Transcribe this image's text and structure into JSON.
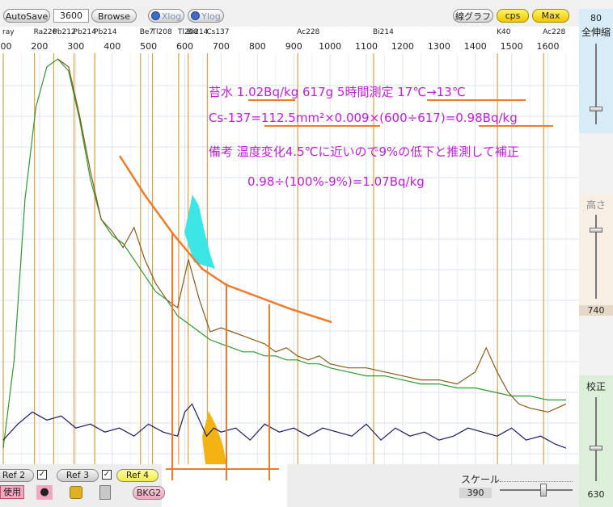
{
  "toolbar": {
    "autosave_label": "AutoSave",
    "time_value": "3600",
    "browse_label": "Browse",
    "xlog_label": "Xlog",
    "ylog_label": "Ylog",
    "line_graph_label": "線グラフ",
    "cps_label": "cps",
    "max_label": "Max",
    "zoom_value": "80"
  },
  "right_panel": {
    "full_zoom_label": "全伸縮",
    "height_label": "高さ",
    "height_value": "740",
    "calibration_label": "校正",
    "calibration_value": "630"
  },
  "bottom": {
    "ref2_label": "Ref 2",
    "ref3_label": "Ref 3",
    "ref4_label": "Ref 4",
    "use_label": "使用",
    "bkg_label": "BKG2",
    "scale_label": "スケール",
    "scale_value": "390"
  },
  "annotations": {
    "line1": "苔水  1.02Bq/kg  617g  5時間測定  17℃→13℃",
    "line2": "Cs-137=112.5mm²×0.009×(600÷617)=0.98Bq/kg",
    "line3": "備考  温度変化4.5℃に近いので9%の低下と推測して補正",
    "line4": "0.98÷(100%-9%)=1.07Bq/kg"
  },
  "chart_data": {
    "type": "line",
    "xlabel": "",
    "ylabel": "",
    "xlim": [
      100,
      1650
    ],
    "x_ticks": [
      100,
      200,
      300,
      400,
      500,
      600,
      700,
      800,
      900,
      1000,
      1100,
      1200,
      1300,
      1400,
      1500,
      1600
    ],
    "grid": true,
    "nuclide_markers": [
      {
        "label": "ray",
        "energy": 100
      },
      {
        "label": "Ra226",
        "energy": 186
      },
      {
        "label": "Pb212",
        "energy": 239
      },
      {
        "label": "Pb214",
        "energy": 295
      },
      {
        "label": "Pb214",
        "energy": 352
      },
      {
        "label": "Be7",
        "energy": 478
      },
      {
        "label": "Tl208",
        "energy": 511
      },
      {
        "label": "Tl208",
        "energy": 583
      },
      {
        "label": "Bi214",
        "energy": 609
      },
      {
        "label": "Cs137",
        "energy": 662
      },
      {
        "label": "Ac228",
        "energy": 911
      },
      {
        "label": "Bi214",
        "energy": 1120
      },
      {
        "label": "K40",
        "energy": 1461
      },
      {
        "label": "Ac228",
        "energy": 1588
      }
    ],
    "series": [
      {
        "color": "#2e9a2e",
        "x": [
          100,
          130,
          160,
          190,
          220,
          250,
          280,
          310,
          340,
          370,
          400,
          430,
          460,
          490,
          520,
          550,
          580,
          610,
          640,
          670,
          700,
          730,
          760,
          790,
          820,
          850,
          880,
          910,
          940,
          970,
          1000,
          1050,
          1100,
          1150,
          1200,
          1250,
          1300,
          1350,
          1400,
          1450,
          1500,
          1550,
          1600,
          1650
        ],
        "y": [
          0.03,
          0.25,
          0.65,
          0.88,
          0.98,
          1.0,
          0.97,
          0.85,
          0.7,
          0.6,
          0.56,
          0.54,
          0.5,
          0.46,
          0.42,
          0.4,
          0.36,
          0.34,
          0.32,
          0.3,
          0.29,
          0.28,
          0.27,
          0.27,
          0.26,
          0.26,
          0.25,
          0.25,
          0.24,
          0.24,
          0.23,
          0.22,
          0.21,
          0.21,
          0.2,
          0.19,
          0.19,
          0.18,
          0.18,
          0.17,
          0.16,
          0.16,
          0.15,
          0.15
        ]
      },
      {
        "color": "#8a5a1a",
        "x": [
          250,
          280,
          310,
          340,
          370,
          400,
          430,
          460,
          490,
          520,
          550,
          580,
          610,
          640,
          670,
          700,
          730,
          760,
          790,
          820,
          850,
          880,
          910,
          940,
          970,
          1000,
          1050,
          1100,
          1150,
          1200,
          1250,
          1300,
          1350,
          1400,
          1430,
          1460,
          1490,
          1520,
          1550,
          1600,
          1650
        ],
        "y": [
          1.0,
          0.98,
          0.86,
          0.72,
          0.6,
          0.57,
          0.53,
          0.58,
          0.5,
          0.44,
          0.4,
          0.38,
          0.5,
          0.4,
          0.32,
          0.33,
          0.32,
          0.31,
          0.3,
          0.29,
          0.27,
          0.28,
          0.26,
          0.25,
          0.26,
          0.24,
          0.23,
          0.23,
          0.22,
          0.21,
          0.2,
          0.2,
          0.19,
          0.22,
          0.28,
          0.22,
          0.17,
          0.14,
          0.13,
          0.12,
          0.14
        ]
      },
      {
        "color": "#1a1a6a",
        "x": [
          100,
          140,
          180,
          220,
          260,
          300,
          340,
          380,
          420,
          460,
          500,
          540,
          580,
          600,
          620,
          640,
          660,
          680,
          700,
          740,
          780,
          820,
          860,
          900,
          940,
          980,
          1020,
          1060,
          1100,
          1140,
          1180,
          1220,
          1260,
          1300,
          1340,
          1380,
          1420,
          1460,
          1500,
          1540,
          1580,
          1620,
          1650
        ],
        "y": [
          0.05,
          0.09,
          0.12,
          0.1,
          0.11,
          0.08,
          0.09,
          0.07,
          0.08,
          0.06,
          0.09,
          0.07,
          0.06,
          0.12,
          0.14,
          0.1,
          0.06,
          0.08,
          0.07,
          0.08,
          0.05,
          0.09,
          0.07,
          0.08,
          0.06,
          0.08,
          0.07,
          0.06,
          0.09,
          0.05,
          0.08,
          0.06,
          0.07,
          0.05,
          0.06,
          0.08,
          0.07,
          0.06,
          0.08,
          0.05,
          0.06,
          0.04,
          0.03
        ]
      }
    ]
  }
}
